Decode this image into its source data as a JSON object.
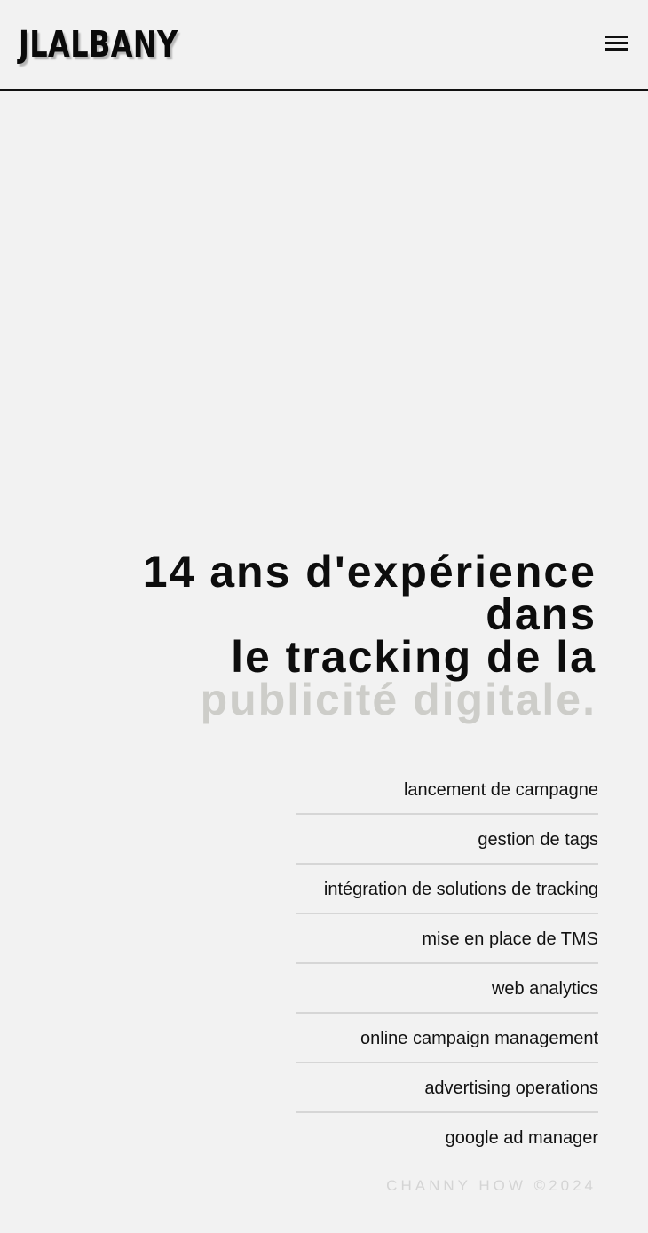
{
  "header": {
    "logo": "JLALBANY",
    "menu_icon": "hamburger-menu-icon"
  },
  "hero": {
    "line1": "14 ans d'expérience",
    "line2": "dans",
    "line3": "le tracking de la",
    "line4_muted": "publicité digitale."
  },
  "services": [
    "lancement de campagne",
    "gestion de tags",
    "intégration de solutions de tracking",
    "mise en place de TMS",
    "web analytics",
    "online campaign management",
    "advertising operations",
    "google ad manager"
  ],
  "footer": {
    "credit": "CHANNY HOW ©2024"
  },
  "colors": {
    "background": "#f2f2f2",
    "text": "#111111",
    "muted_heading": "#cdcdc9",
    "divider": "#d6d6d6",
    "footer": "#d4d4d4"
  }
}
